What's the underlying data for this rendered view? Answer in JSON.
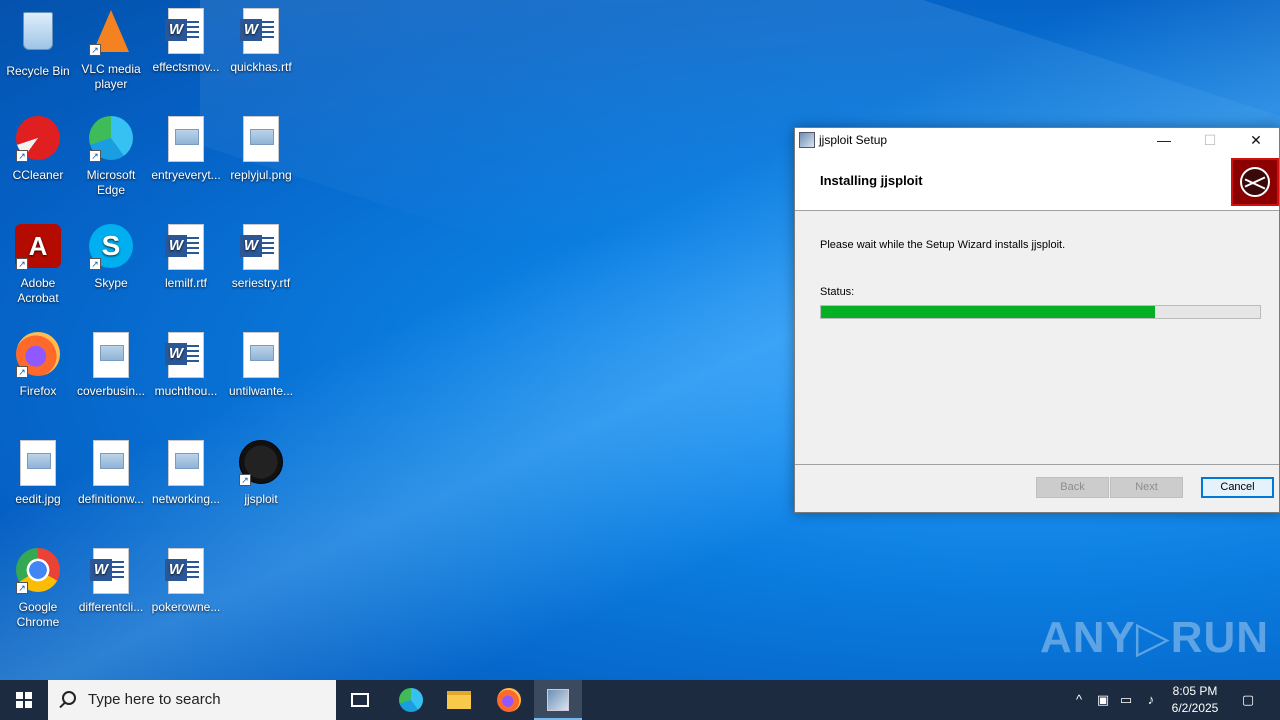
{
  "desktop": {
    "icons": [
      {
        "label": "Recycle Bin"
      },
      {
        "label": "VLC media player"
      },
      {
        "label": "effectsmov..."
      },
      {
        "label": "quickhas.rtf"
      },
      {
        "label": "CCleaner"
      },
      {
        "label": "Microsoft Edge"
      },
      {
        "label": "entryeveryt..."
      },
      {
        "label": "replyjul.png"
      },
      {
        "label": "Adobe Acrobat"
      },
      {
        "label": "Skype"
      },
      {
        "label": "lemilf.rtf"
      },
      {
        "label": "seriestry.rtf"
      },
      {
        "label": "Firefox"
      },
      {
        "label": "coverbusin..."
      },
      {
        "label": "muchthou..."
      },
      {
        "label": "untilwante..."
      },
      {
        "label": "eedit.jpg"
      },
      {
        "label": "definitionw..."
      },
      {
        "label": "networking..."
      },
      {
        "label": "jjsploit"
      },
      {
        "label": "Google Chrome"
      },
      {
        "label": "differentcli..."
      },
      {
        "label": "pokerowne..."
      }
    ]
  },
  "setup_window": {
    "title": "jjsploit Setup",
    "heading": "Installing jjsploit",
    "message": "Please wait while the Setup Wizard installs jjsploit.",
    "status_label": "Status:",
    "progress_fraction": 0.76,
    "buttons": {
      "back": "Back",
      "next": "Next",
      "cancel": "Cancel"
    },
    "controls": {
      "minimize": "—",
      "maximize": "☐",
      "close": "✕"
    }
  },
  "watermark": "ANY▷RUN",
  "taskbar": {
    "search_placeholder": "Type here to search",
    "time": "8:05 PM",
    "date": "6/2/2025"
  },
  "colors": {
    "progress": "#06b025",
    "taskbar": "#1c2b3f",
    "accent": "#0078d7"
  }
}
